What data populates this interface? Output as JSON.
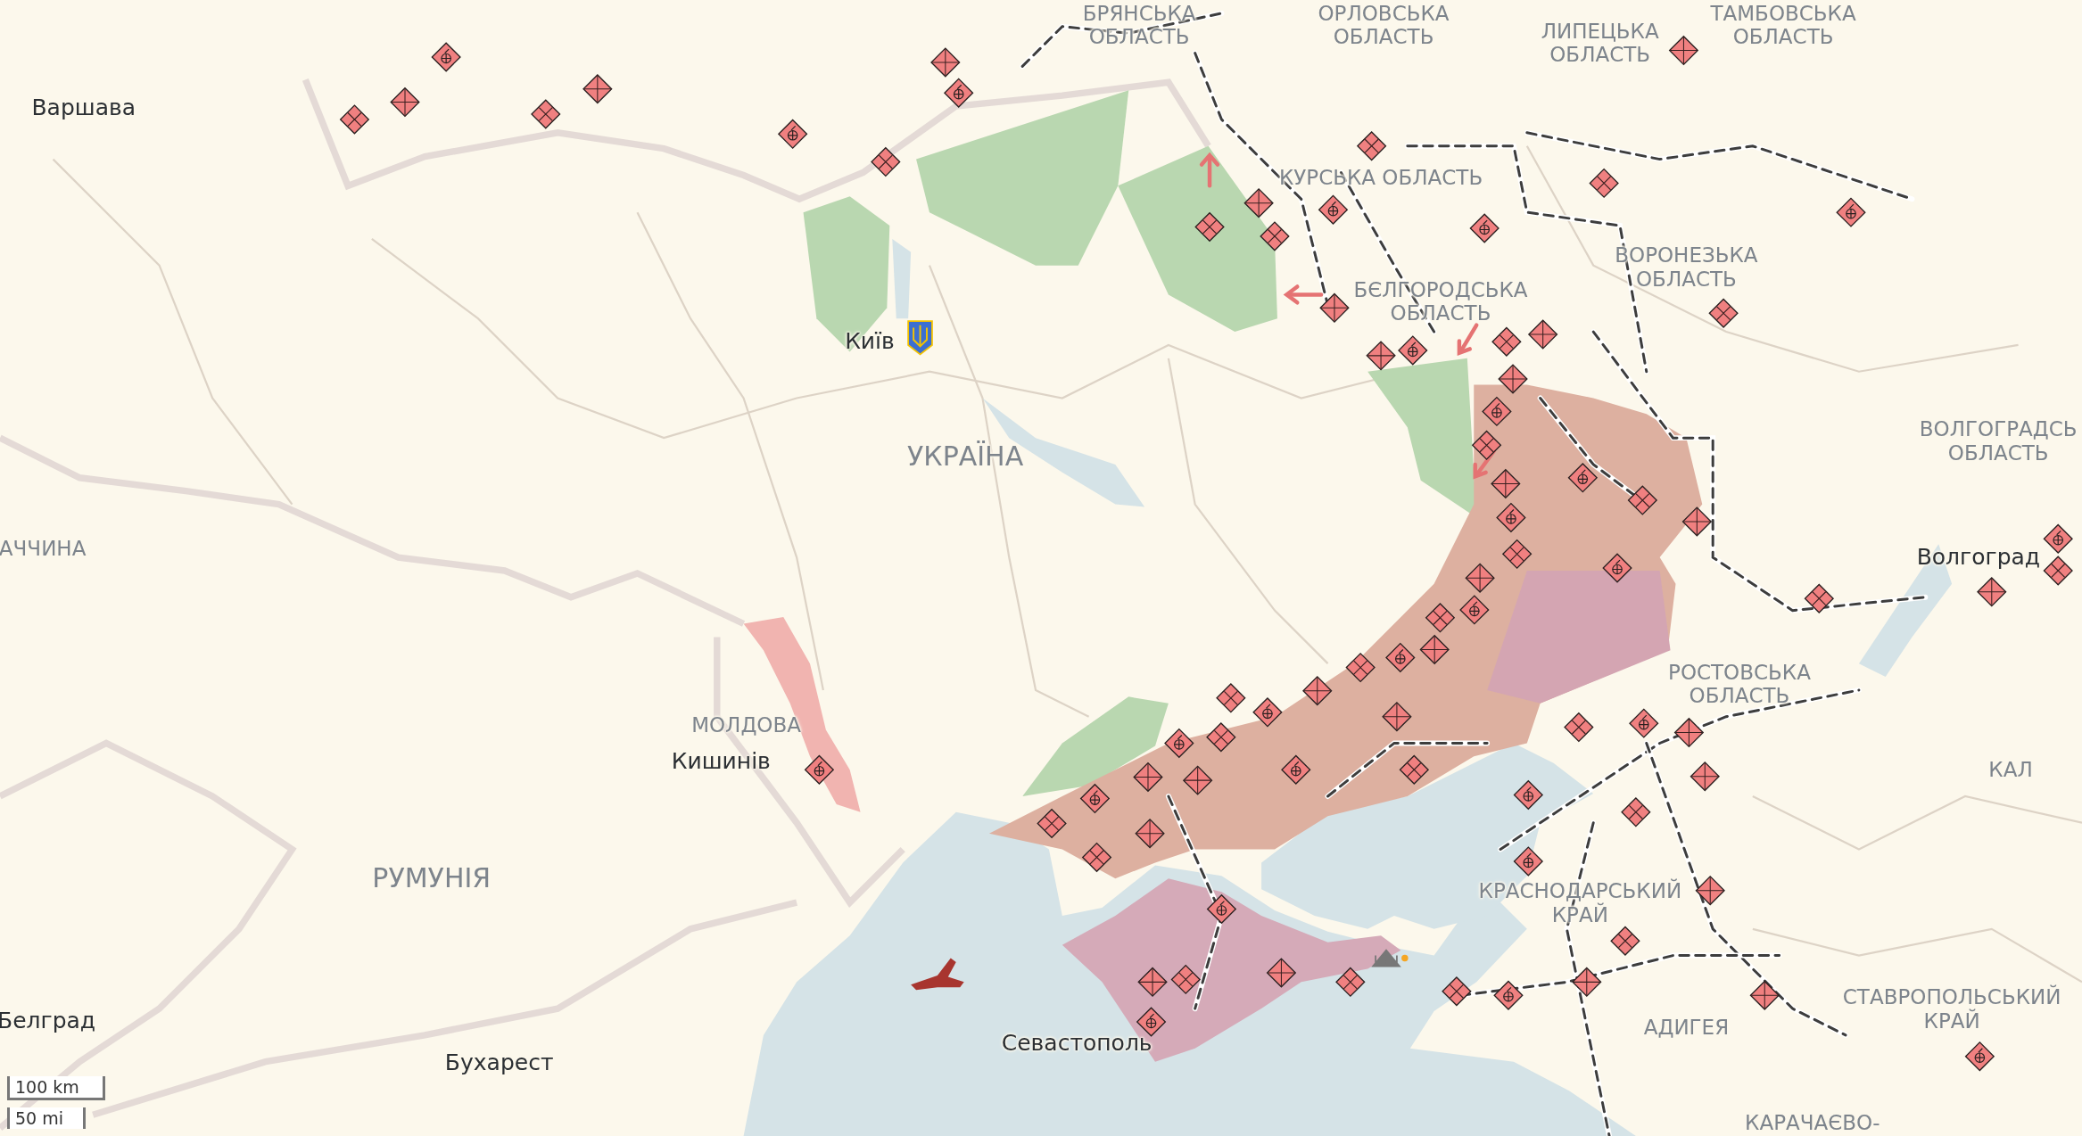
{
  "map": {
    "labels": [
      {
        "kind": "region",
        "lines": [
          "БРЯНСЬКА",
          "ОБЛАСТЬ"
        ]
      },
      {
        "kind": "region",
        "lines": [
          "ОРЛОВСЬКА",
          "ОБЛАСТЬ"
        ]
      },
      {
        "kind": "region",
        "lines": [
          "ЛИПЕЦЬКА",
          "ОБЛАСТЬ"
        ]
      },
      {
        "kind": "region",
        "lines": [
          "ТАМБОВСЬКА",
          "ОБЛАСТЬ"
        ]
      },
      {
        "kind": "city",
        "lines": [
          "Варшава"
        ]
      },
      {
        "kind": "region",
        "lines": [
          "КУРСЬКА ОБЛАСТЬ"
        ]
      },
      {
        "kind": "region",
        "lines": [
          "ВОРОНЕЗЬКА",
          "ОБЛАСТЬ"
        ]
      },
      {
        "kind": "region",
        "lines": [
          "БЄЛГОРОДСЬКА",
          "ОБЛАСТЬ"
        ]
      },
      {
        "kind": "city",
        "lines": [
          "Київ"
        ]
      },
      {
        "kind": "country",
        "lines": [
          "УКРАЇНА"
        ]
      },
      {
        "kind": "region",
        "lines": [
          "ВОЛГОГРАДСЬ",
          "ОБЛАСТЬ"
        ]
      },
      {
        "kind": "region",
        "lines": [
          "АЧЧИНА"
        ]
      },
      {
        "kind": "city",
        "lines": [
          "Волгоград"
        ]
      },
      {
        "kind": "region",
        "lines": [
          "РОСТОВСЬКА",
          "ОБЛАСТЬ"
        ]
      },
      {
        "kind": "region",
        "lines": [
          "МОЛДОВА"
        ]
      },
      {
        "kind": "city",
        "lines": [
          "Кишинів"
        ]
      },
      {
        "kind": "region",
        "lines": [
          "КАЛ"
        ]
      },
      {
        "kind": "country",
        "lines": [
          "РУМУНІЯ"
        ]
      },
      {
        "kind": "region",
        "lines": [
          "КРАСНОДАРСЬКИЙ",
          "КРАЙ"
        ]
      },
      {
        "kind": "city",
        "lines": [
          "Белград"
        ]
      },
      {
        "kind": "region",
        "lines": [
          "СТАВРОПОЛЬСЬКИЙ",
          "КРАЙ"
        ]
      },
      {
        "kind": "region",
        "lines": [
          "АДИГЕЯ"
        ]
      },
      {
        "kind": "city",
        "lines": [
          "Севастополь"
        ]
      },
      {
        "kind": "city",
        "lines": [
          "Бухарест"
        ]
      },
      {
        "kind": "region",
        "lines": [
          "КАРАЧАЄВО-"
        ]
      }
    ]
  },
  "scale": [
    "100 km",
    "50 mi"
  ]
}
